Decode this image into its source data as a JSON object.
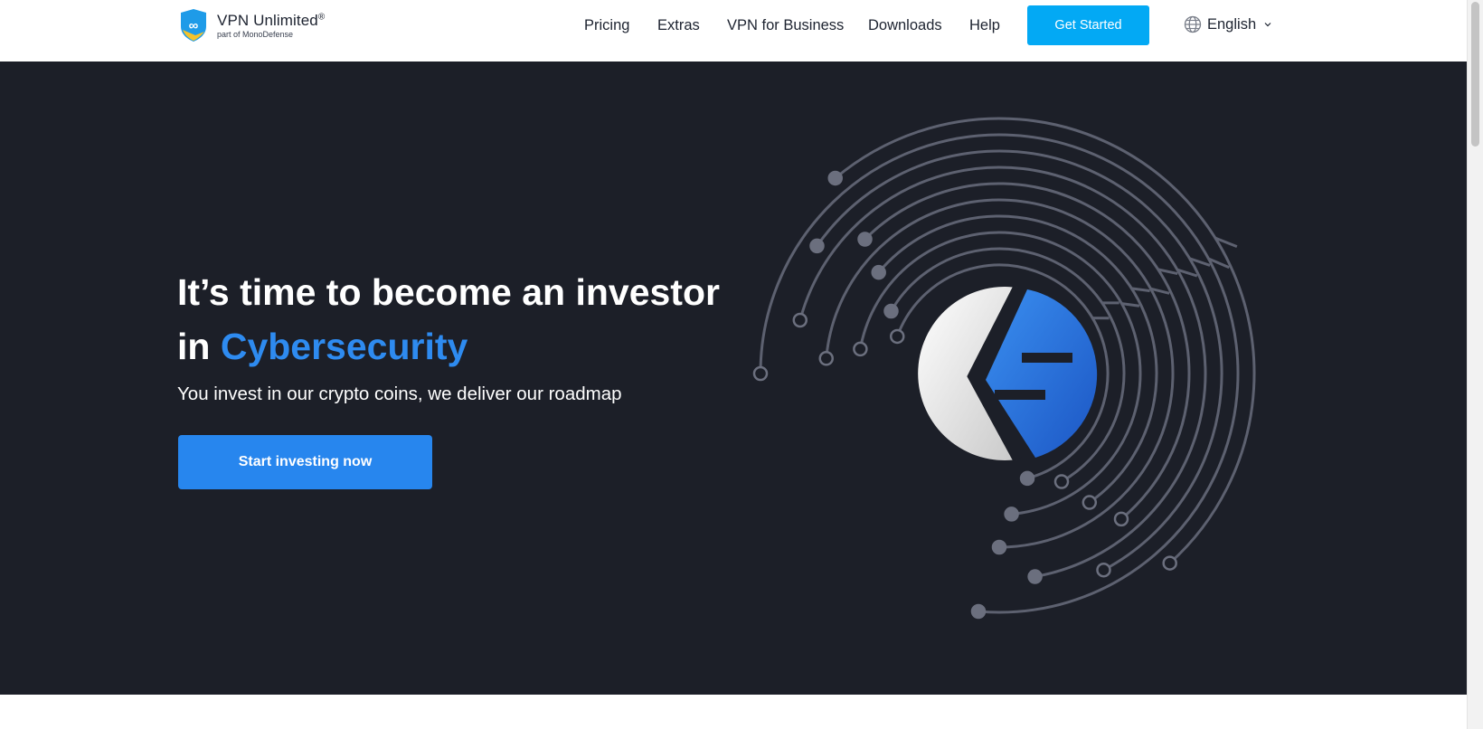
{
  "brand": {
    "name": "VPN Unlimited",
    "registered": "®",
    "tagline": "part of MonoDefense"
  },
  "nav": {
    "items": [
      {
        "label": "Pricing"
      },
      {
        "label": "Extras"
      },
      {
        "label": "VPN for Business"
      },
      {
        "label": "Downloads"
      },
      {
        "label": "Help"
      }
    ],
    "cta_label": "Get Started",
    "language": "English"
  },
  "hero": {
    "headline_line1": "It’s time to become an investor",
    "headline_in": "in",
    "headline_accent": "Cybersecurity",
    "subheadline": "You invest in our crypto coins, we deliver our roadmap",
    "cta_label": "Start investing now"
  },
  "colors": {
    "hero_background": "#1c1f28",
    "accent_blue": "#2e8bf0",
    "button_blue": "#2786ee",
    "header_cta": "#03a9f4"
  }
}
